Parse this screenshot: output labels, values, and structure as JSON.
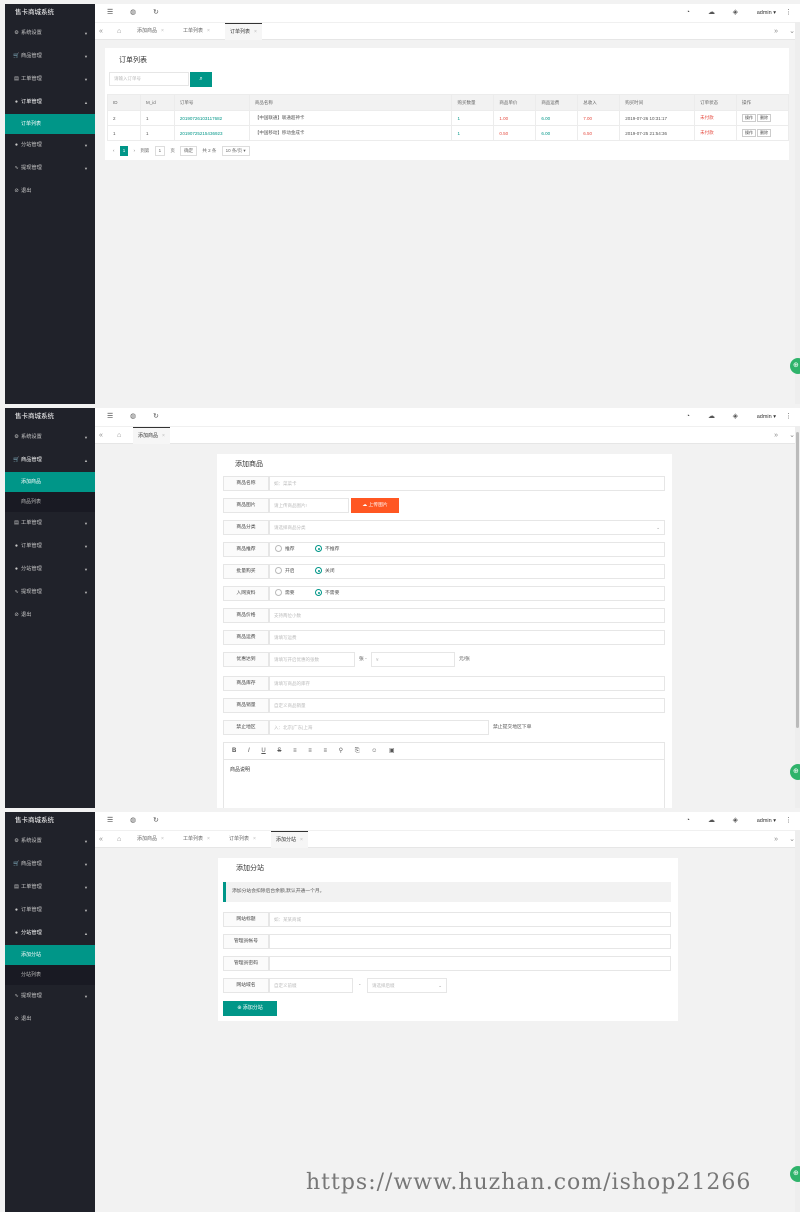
{
  "app": {
    "title": "售卡商城系统",
    "admin_label": "admin ▾",
    "nav": [
      "系统设置",
      "商品管理",
      "工单管理",
      "订单管理",
      "分站管理",
      "提现管理",
      "退出"
    ],
    "sub": {
      "order_list": "订单列表",
      "add_goods": "添加商品",
      "goods_list": "商品列表",
      "add_substation": "添加分站",
      "substation_list": "分站列表"
    }
  },
  "tabs": {
    "add_goods": "添加商品",
    "ticket_list": "工单列表",
    "order_list": "订单列表",
    "add_substation": "添加分站"
  },
  "orders": {
    "title": "订单列表",
    "search_placeholder": "请输入订单号",
    "columns": [
      "ID",
      "M_id",
      "订单号",
      "商品名称",
      "购买数量",
      "商品单价",
      "商品运费",
      "总收入",
      "购买时间",
      "订单状态",
      "操作"
    ],
    "rows": [
      [
        "2",
        "1",
        "20190726103117682",
        "【中国联通】联通超神卡",
        "1",
        "1.00",
        "6.00",
        "7.00",
        "2019-07-26 10:31:17",
        "未付款"
      ],
      [
        "1",
        "1",
        "20190725215436923",
        "【中国移动】移动金成卡",
        "1",
        "0.50",
        "6.00",
        "6.50",
        "2019-07-25 21:54:36",
        "未付款"
      ]
    ],
    "btn_op": "操作",
    "btn_del": "删除",
    "pager": {
      "page": "1",
      "goto": "到第",
      "page_input": "1",
      "unit": "页",
      "confirm": "确定",
      "total": "共 2 条",
      "per_page": "10 条/页 ▾"
    }
  },
  "goods_form": {
    "title": "添加商品",
    "name_label": "商品名称",
    "name_ph": "如：菜菜卡",
    "image_label": "商品图片",
    "image_ph": "请上传商品图片!",
    "upload_btn": "上传图片",
    "category_label": "商品分类",
    "category_ph": "请选择商品分类",
    "recommend_label": "商品推荐",
    "recommend_opts": [
      "推荐",
      "不推荐"
    ],
    "bulk_label": "批量购买",
    "bulk_opts": [
      "开启",
      "关闭"
    ],
    "info_label": "入网资料",
    "info_opts": [
      "需要",
      "不需要"
    ],
    "price_label": "商品价格",
    "price_ph": "支持两位小数",
    "shipping_label": "商品运费",
    "shipping_ph": "请填写运费",
    "discount_label": "优惠达到",
    "discount_ph": "请填写开启优惠的张数",
    "discount_mid": "张 -",
    "discount_ph2": "¥",
    "discount_unit": "元/张",
    "stock_label": "商品库存",
    "stock_ph": "请填写商品的库存",
    "sales_label": "商品销量",
    "sales_ph": "自定义商品销量",
    "region_label": "禁止地区",
    "region_ph": "入：北京|广东|上海",
    "region_note": "禁止提交地区下单",
    "editor_tools": [
      "B",
      "I",
      "U",
      "S",
      "≡",
      "≡",
      "≡",
      "⚲",
      "⎘",
      "☺",
      "▣"
    ],
    "desc_text": "商品说明"
  },
  "sub_form": {
    "title": "添加分站",
    "notice": "添加分站会扣除后台余额,默认开通一个月。",
    "site_title_label": "网站标题",
    "site_title_ph": "如：某某商城",
    "account_label": "管理员帐号",
    "password_label": "管理员密码",
    "domain_label": "网站域名",
    "domain_ph": "自定义前缀",
    "domain_sep": "-",
    "domain_select_ph": "请选择后缀",
    "submit_btn": "⊕ 添加分站"
  },
  "watermark": "https://www.huzhan.com/ishop21266",
  "colors": {
    "sidebar": "#20222a",
    "accent": "#009688",
    "upload": "#ff5722",
    "alert": "#e54d42"
  }
}
